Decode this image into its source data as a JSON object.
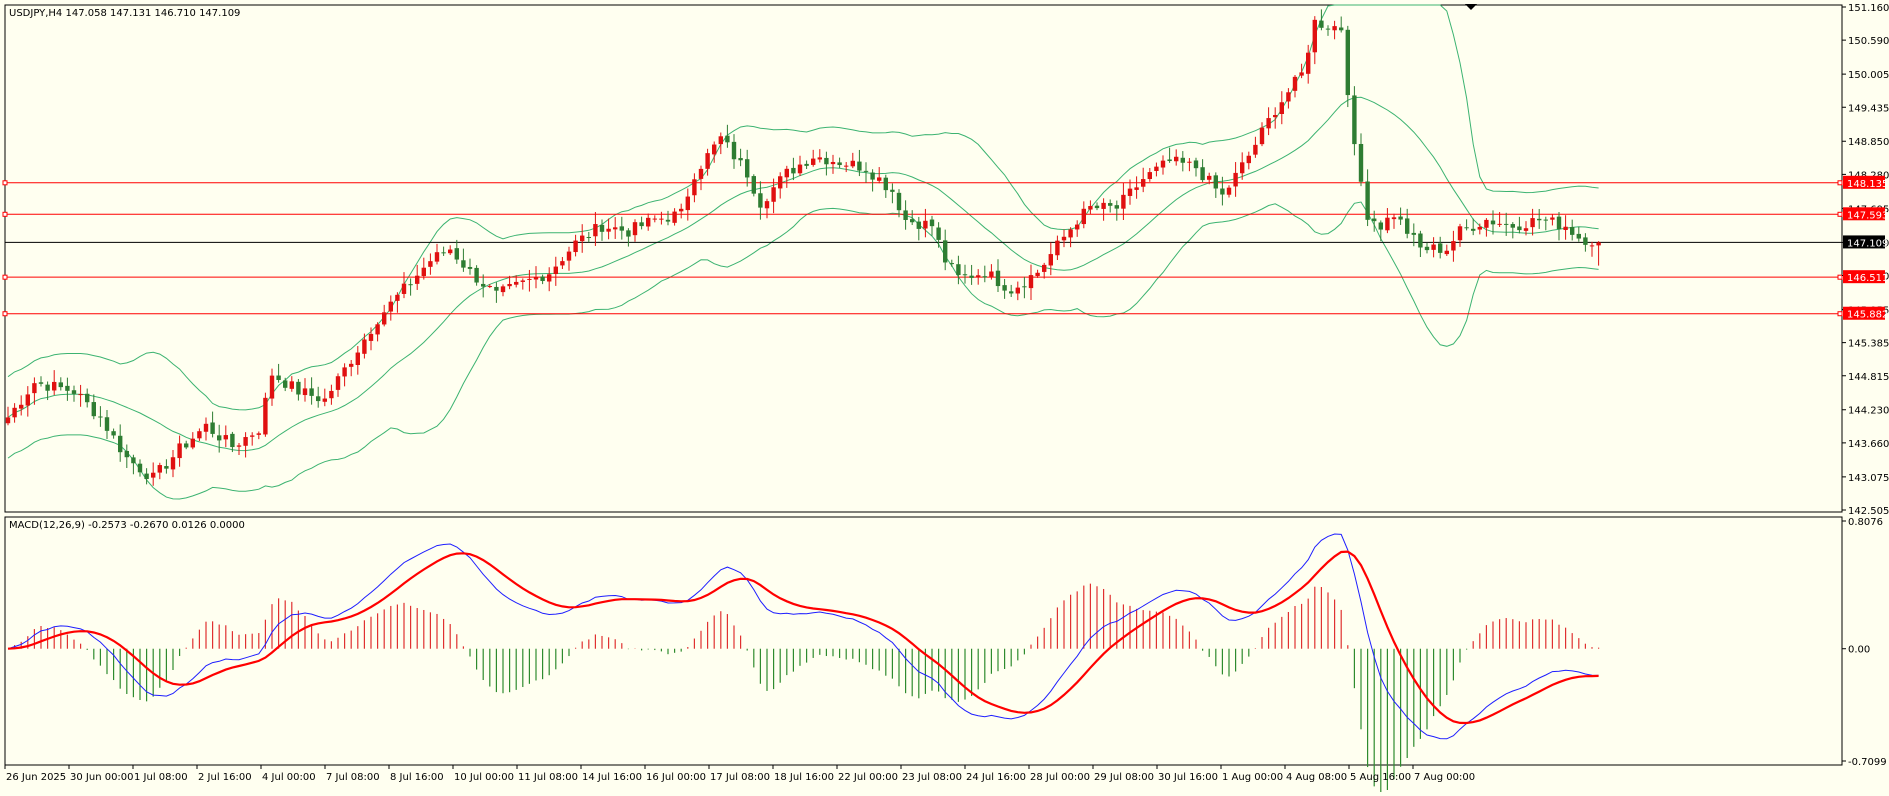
{
  "main_panel": {
    "header": "USDJPY,H4  147.058 147.131 146.710 147.109"
  },
  "macd_panel": {
    "header": "MACD(12,26,9) -0.2573 -0.2670 0.0126 0.0000"
  },
  "colors": {
    "background": "#fffff0",
    "bull_candle": "#e01010",
    "bear_candle": "#2e7d32",
    "bollinger": "#3cb371",
    "level_line": "#ff0000",
    "price_line": "#000000",
    "macd_line": "#1e1eff",
    "signal_line": "#ff0000",
    "hist_positive": "#e03030",
    "hist_negative": "#2e8b2e"
  },
  "chart_data": [
    {
      "type": "candlestick",
      "symbol": "USDJPY",
      "timeframe": "H4",
      "last_bar": {
        "open": 147.058,
        "high": 147.131,
        "low": 146.71,
        "close": 147.109
      },
      "current_price": 147.109,
      "current_price_label": "147.109",
      "ylim": [
        142.505,
        151.16
      ],
      "y_ticks": [
        "151.160",
        "150.590",
        "150.005",
        "149.435",
        "148.850",
        "148.280",
        "147.695",
        "147.109",
        "146.540",
        "145.955",
        "145.385",
        "144.815",
        "144.230",
        "143.660",
        "143.075",
        "142.505"
      ],
      "x_tick_labels": [
        "26 Jun 2025",
        "30 Jun 00:00",
        "1 Jul 08:00",
        "2 Jul 16:00",
        "4 Jul 00:00",
        "7 Jul 08:00",
        "8 Jul 16:00",
        "10 Jul 00:00",
        "11 Jul 08:00",
        "14 Jul 16:00",
        "16 Jul 00:00",
        "17 Jul 08:00",
        "18 Jul 16:00",
        "22 Jul 00:00",
        "23 Jul 08:00",
        "24 Jul 16:00",
        "28 Jul 00:00",
        "29 Jul 08:00",
        "30 Jul 16:00",
        "1 Aug 00:00",
        "4 Aug 08:00",
        "5 Aug 16:00",
        "7 Aug 00:00"
      ],
      "horizontal_levels": [
        {
          "value": 148.135,
          "label": "148.135"
        },
        {
          "value": 147.593,
          "label": "147.593"
        },
        {
          "value": 146.511,
          "label": "146.511"
        },
        {
          "value": 145.882,
          "label": "145.882"
        }
      ],
      "close_anchors": [
        [
          0,
          144.1
        ],
        [
          4,
          144.7
        ],
        [
          10,
          144.55
        ],
        [
          14,
          144.1
        ],
        [
          18,
          143.4
        ],
        [
          22,
          143.05
        ],
        [
          26,
          143.55
        ],
        [
          30,
          143.95
        ],
        [
          34,
          143.6
        ],
        [
          38,
          143.9
        ],
        [
          40,
          144.85
        ],
        [
          44,
          144.55
        ],
        [
          48,
          144.4
        ],
        [
          52,
          145.1
        ],
        [
          56,
          145.8
        ],
        [
          60,
          146.3
        ],
        [
          64,
          146.8
        ],
        [
          67,
          147.0
        ],
        [
          70,
          146.6
        ],
        [
          74,
          146.2
        ],
        [
          78,
          146.4
        ],
        [
          82,
          146.6
        ],
        [
          86,
          147.1
        ],
        [
          90,
          147.4
        ],
        [
          94,
          147.3
        ],
        [
          98,
          147.5
        ],
        [
          102,
          147.6
        ],
        [
          104,
          148.3
        ],
        [
          108,
          148.9
        ],
        [
          112,
          148.3
        ],
        [
          114,
          147.8
        ],
        [
          118,
          148.3
        ],
        [
          122,
          148.6
        ],
        [
          126,
          148.5
        ],
        [
          130,
          148.4
        ],
        [
          134,
          148.0
        ],
        [
          136,
          147.5
        ],
        [
          140,
          147.4
        ],
        [
          142,
          146.8
        ],
        [
          144,
          146.5
        ],
        [
          148,
          146.6
        ],
        [
          152,
          146.3
        ],
        [
          156,
          146.6
        ],
        [
          158,
          146.9
        ],
        [
          162,
          147.5
        ],
        [
          164,
          147.7
        ],
        [
          168,
          147.7
        ],
        [
          172,
          148.2
        ],
        [
          176,
          148.5
        ],
        [
          180,
          148.4
        ],
        [
          184,
          147.9
        ],
        [
          188,
          148.6
        ],
        [
          192,
          149.4
        ],
        [
          196,
          150.0
        ],
        [
          198,
          150.9
        ],
        [
          202,
          150.8
        ],
        [
          204,
          148.7
        ],
        [
          206,
          147.6
        ],
        [
          208,
          147.4
        ],
        [
          210,
          147.6
        ],
        [
          214,
          147.0
        ],
        [
          218,
          147.0
        ],
        [
          220,
          147.3
        ],
        [
          224,
          147.5
        ],
        [
          228,
          147.4
        ],
        [
          232,
          147.5
        ],
        [
          236,
          147.4
        ],
        [
          238,
          147.2
        ],
        [
          241,
          147.11
        ]
      ],
      "indicators": [
        "Bollinger Bands"
      ]
    },
    {
      "type": "macd",
      "params": "MACD(12,26,9)",
      "values": {
        "macd": -0.2573,
        "signal": -0.267,
        "histogram": 0.0126,
        "zero": 0.0
      },
      "ylim": [
        -0.7099,
        0.8076
      ],
      "y_ticks": [
        "0.8076",
        "0.00",
        "-0.7099"
      ]
    }
  ]
}
